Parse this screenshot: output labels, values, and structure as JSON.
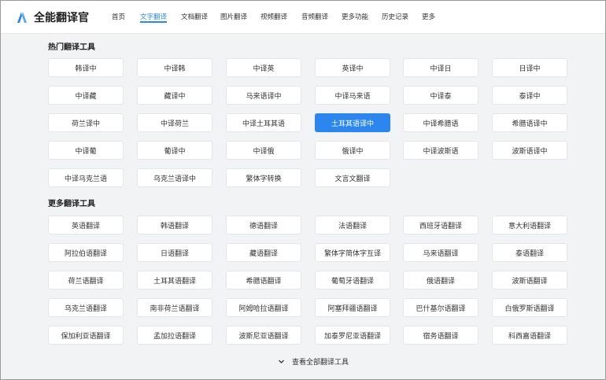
{
  "brand": {
    "name": "全能翻译官",
    "color": "#2b87ee"
  },
  "nav": [
    {
      "label": "首页",
      "active": false
    },
    {
      "label": "文字翻译",
      "active": true
    },
    {
      "label": "文档翻译",
      "active": false
    },
    {
      "label": "图片翻译",
      "active": false
    },
    {
      "label": "视频翻译",
      "active": false
    },
    {
      "label": "音频翻译",
      "active": false
    },
    {
      "label": "更多功能",
      "active": false
    },
    {
      "label": "历史记录",
      "active": false
    },
    {
      "label": "更多",
      "active": false
    }
  ],
  "hot_section": {
    "title": "热门翻译工具",
    "items": [
      "韩译中",
      "中译韩",
      "中译英",
      "英译中",
      "中译日",
      "日译中",
      "中译藏",
      "藏译中",
      "马来语译中",
      "中译马来语",
      "中译泰",
      "泰译中",
      "荷兰译中",
      "中译荷兰",
      "中译土耳其语",
      "土耳其语译中",
      "中译希腊语",
      "希腊语译中",
      "中译葡",
      "葡译中",
      "中译俄",
      "俄译中",
      "中译波斯语",
      "波斯语译中",
      "中译乌克兰语",
      "乌克兰语译中",
      "繁体字转换",
      "文言文翻译"
    ],
    "active_item": "土耳其语译中"
  },
  "more_section": {
    "title": "更多翻译工具",
    "items": [
      "英语翻译",
      "韩语翻译",
      "德语翻译",
      "法语翻译",
      "西班牙语翻译",
      "意大利语翻译",
      "阿拉伯语翻译",
      "日语翻译",
      "藏语翻译",
      "繁体字简体字互译",
      "马来语翻译",
      "泰语翻译",
      "荷兰语翻译",
      "土耳其语翻译",
      "希腊语翻译",
      "葡萄牙语翻译",
      "俄语翻译",
      "波斯语翻译",
      "乌克兰语翻译",
      "南非荷兰语翻译",
      "阿姆哈拉语翻译",
      "阿塞拜疆语翻译",
      "巴什基尔语翻译",
      "白俄罗斯语翻译",
      "保加利亚语翻译",
      "孟加拉语翻译",
      "波斯尼亚语翻译",
      "加泰罗尼亚语翻译",
      "宿务语翻译",
      "科西嘉语翻译"
    ]
  },
  "view_all": {
    "label": "查看全部翻译工具",
    "icon": "chevron-down-icon"
  }
}
